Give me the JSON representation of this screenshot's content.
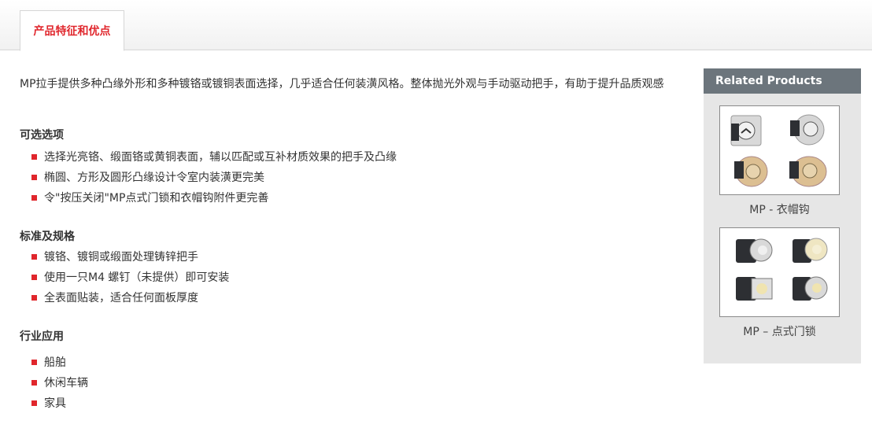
{
  "tabs": [
    {
      "label": "产品特征和优点"
    }
  ],
  "intro": "MP拉手提供多种凸缘外形和多种镀铬或镀铜表面选择，几乎适合任何装潢风格。整体抛光外观与手动驱动把手，有助于提升品质观感",
  "sections": [
    {
      "title": "可选选项",
      "items": [
        "选择光亮铬、缎面铬或黄铜表面，辅以匹配或互补材质效果的把手及凸缘",
        "椭圆、方形及圆形凸缘设计令室内装潢更完美",
        "令\"按压关闭\"MP点式门锁和衣帽钩附件更完善"
      ]
    },
    {
      "title": "标准及规格",
      "items": [
        "镀铬、镀铜或缎面处理铸锌把手",
        "使用一只M4 螺钉（未提供）即可安装",
        "全表面贴装，适合任何面板厚度"
      ]
    },
    {
      "title": "行业应用",
      "items": [
        "船舶",
        "休闲车辆",
        "家具"
      ]
    }
  ],
  "sidebar": {
    "title": "Related Products",
    "products": [
      {
        "caption": "MP - 衣帽钩"
      },
      {
        "caption": "MP – 点式门锁"
      }
    ]
  },
  "colors": {
    "accent": "#e0262c",
    "sidebar_header": "#6c757c",
    "sidebar_bg": "#e6e6e6"
  }
}
